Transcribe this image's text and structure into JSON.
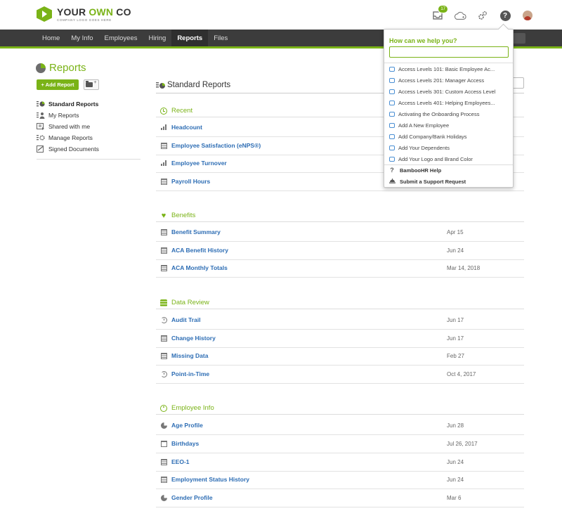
{
  "header": {
    "logo_main_a": "YOUR ",
    "logo_main_b": "OWN",
    "logo_main_c": " CO",
    "logo_sub": "COMPANY LOGO GOES HERE",
    "inbox_badge": "17",
    "help_glyph": "?"
  },
  "nav": {
    "items": [
      "Home",
      "My Info",
      "Employees",
      "Hiring",
      "Reports",
      "Files"
    ],
    "active": "Reports"
  },
  "page": {
    "title": "Reports",
    "add_report": "+ Add Report"
  },
  "sidebar": {
    "items": [
      {
        "label": "Standard Reports",
        "icon": "standard-reports-icon",
        "active": true
      },
      {
        "label": "My Reports",
        "icon": "person-icon"
      },
      {
        "label": "Shared with me",
        "icon": "shared-icon"
      },
      {
        "label": "Manage Reports",
        "icon": "gear-icon"
      },
      {
        "label": "Signed Documents",
        "icon": "signature-icon"
      }
    ]
  },
  "main": {
    "title": "Standard Reports",
    "sections": [
      {
        "title": "Recent",
        "icon": "clock-icon",
        "rows": [
          {
            "name": "Headcount",
            "icon": "bar-chart-icon",
            "date": ""
          },
          {
            "name": "Employee Satisfaction (eNPS®)",
            "icon": "table-icon",
            "date": ""
          },
          {
            "name": "Employee Turnover",
            "icon": "bar-chart-icon",
            "date": ""
          },
          {
            "name": "Payroll Hours",
            "icon": "table-icon",
            "date": ""
          }
        ]
      },
      {
        "title": "Benefits",
        "icon": "heart-icon",
        "rows": [
          {
            "name": "Benefit Summary",
            "icon": "table-icon",
            "date": "Apr 15"
          },
          {
            "name": "ACA Benefit History",
            "icon": "table-icon",
            "date": "Jun 24"
          },
          {
            "name": "ACA Monthly Totals",
            "icon": "table-icon",
            "date": "Mar 14, 2018"
          }
        ]
      },
      {
        "title": "Data Review",
        "icon": "stack-icon",
        "rows": [
          {
            "name": "Audit Trail",
            "icon": "history-icon",
            "date": "Jun 17"
          },
          {
            "name": "Change History",
            "icon": "table-icon",
            "date": "Jun 17"
          },
          {
            "name": "Missing Data",
            "icon": "table-icon",
            "date": "Feb 27"
          },
          {
            "name": "Point-in-Time",
            "icon": "history-icon",
            "date": "Oct 4, 2017"
          }
        ]
      },
      {
        "title": "Employee Info",
        "icon": "person-circle-icon",
        "rows": [
          {
            "name": "Age Profile",
            "icon": "pie-chart-icon",
            "date": "Jun 28"
          },
          {
            "name": "Birthdays",
            "icon": "calendar-icon",
            "date": "Jul 26, 2017"
          },
          {
            "name": "EEO-1",
            "icon": "table-icon",
            "date": "Jun 24"
          },
          {
            "name": "Employment Status History",
            "icon": "table-icon",
            "date": "Jun 24"
          },
          {
            "name": "Gender Profile",
            "icon": "pie-chart-icon",
            "date": "Mar 6"
          }
        ]
      }
    ]
  },
  "help": {
    "title": "How can we help you?",
    "input_value": "",
    "items": [
      "Access Levels 101: Basic Employee Ac...",
      "Access Levels 201: Manager Access",
      "Access Levels 301: Custom Access Level",
      "Access Levels 401: Helping Employees...",
      "Activating the Onboarding Process",
      "Add A New Employee",
      "Add Company/Bank Holidays",
      "Add Your Dependents",
      "Add Your Logo and Brand Color"
    ],
    "footer_help": "BambooHR Help",
    "footer_help_glyph": "?",
    "footer_support": "Submit a Support Request"
  },
  "colors": {
    "accent": "#7ab317",
    "nav_bg": "#3c3c3c",
    "link": "#2d6db4"
  }
}
